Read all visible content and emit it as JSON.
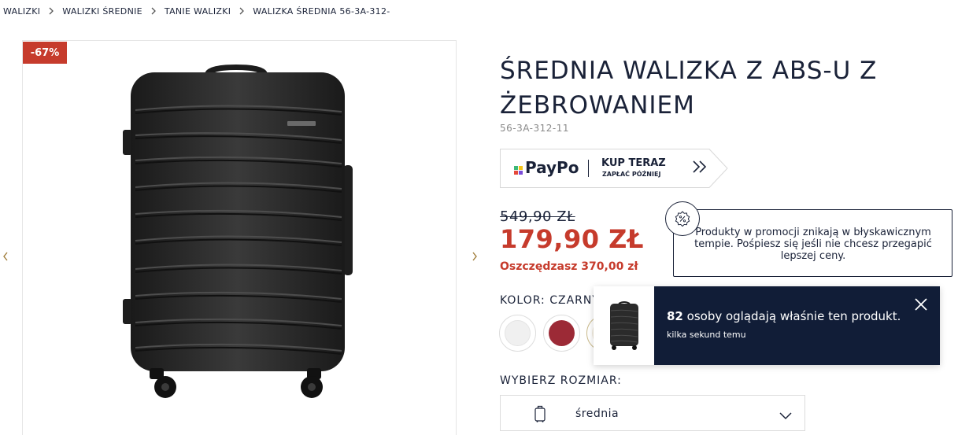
{
  "breadcrumb": {
    "items": [
      "WALIZKI",
      "WALIZKI ŚREDNIE",
      "TANIE WALIZKI",
      "WALIZKA ŚREDNIA 56-3A-312-"
    ]
  },
  "gallery": {
    "discount_badge": "-67%"
  },
  "product": {
    "title": "ŚREDNIA WALIZKA Z ABS-U Z ŻEBROWANIEM",
    "sku": "56-3A-312-11"
  },
  "paypo": {
    "brand": "PayPo",
    "cta": "KUP TERAZ",
    "subtext": "ZAPŁAĆ PÓŹNIEJ"
  },
  "price": {
    "old": "549,90 ZŁ",
    "current": "179,90 ZŁ",
    "savings": "Oszczędzasz 370,00 zł"
  },
  "color": {
    "label": "KOLOR: CZARNY",
    "swatches": [
      {
        "name": "white",
        "color": "#f0f0f0"
      },
      {
        "name": "burgundy",
        "color": "#9c2a36"
      },
      {
        "name": "gold",
        "color": "#f3ede0"
      }
    ]
  },
  "size": {
    "label": "WYBIERZ ROZMIAR:",
    "selected": "średnia"
  },
  "promo_tooltip": {
    "text": "Produkty w promocji znikają w błyskawicznym tempie. Pośpiesz się jeśli nie chcesz przegapić lepszej ceny."
  },
  "toast": {
    "viewers_count": "82",
    "viewers_text": " osoby oglądają właśnie ten produkt.",
    "time": "kilka sekund temu"
  },
  "colors": {
    "accent_red": "#c63b2c",
    "navy": "#111d37",
    "gold_arrow": "#a07d3a"
  }
}
